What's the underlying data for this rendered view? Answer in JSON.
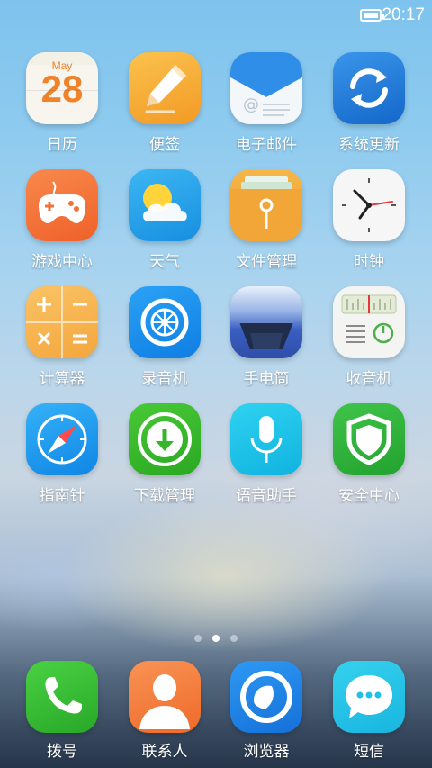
{
  "status_bar": {
    "time": "20:17"
  },
  "calendar": {
    "month": "May",
    "day": "28"
  },
  "apps": [
    {
      "id": "calendar",
      "label": "日历",
      "icon": "calendar-icon"
    },
    {
      "id": "notes",
      "label": "便签",
      "icon": "pencil-icon"
    },
    {
      "id": "email",
      "label": "电子邮件",
      "icon": "envelope-icon"
    },
    {
      "id": "system-update",
      "label": "系统更新",
      "icon": "refresh-icon"
    },
    {
      "id": "games",
      "label": "游戏中心",
      "icon": "gamepad-icon"
    },
    {
      "id": "weather",
      "label": "天气",
      "icon": "sun-cloud-icon"
    },
    {
      "id": "file-manager",
      "label": "文件管理",
      "icon": "folder-icon"
    },
    {
      "id": "clock",
      "label": "时钟",
      "icon": "clock-icon"
    },
    {
      "id": "calculator",
      "label": "计算器",
      "icon": "calculator-icon"
    },
    {
      "id": "recorder",
      "label": "录音机",
      "icon": "recorder-icon"
    },
    {
      "id": "flashlight",
      "label": "手电筒",
      "icon": "flashlight-icon"
    },
    {
      "id": "radio",
      "label": "收音机",
      "icon": "radio-icon"
    },
    {
      "id": "compass",
      "label": "指南针",
      "icon": "compass-icon"
    },
    {
      "id": "downloads",
      "label": "下载管理",
      "icon": "download-icon"
    },
    {
      "id": "voice-assistant",
      "label": "语音助手",
      "icon": "microphone-icon"
    },
    {
      "id": "security",
      "label": "安全中心",
      "icon": "shield-icon"
    }
  ],
  "dock": [
    {
      "id": "phone",
      "label": "拨号",
      "icon": "phone-icon"
    },
    {
      "id": "contacts",
      "label": "联系人",
      "icon": "contact-icon"
    },
    {
      "id": "browser",
      "label": "浏览器",
      "icon": "browser-icon"
    },
    {
      "id": "messages",
      "label": "短信",
      "icon": "message-icon"
    }
  ],
  "page_indicator": {
    "pages": 3,
    "current": 2
  },
  "colors": {
    "calendar_accent": "#f0822a",
    "notes_bg": "#f8b23c",
    "update_bg": "#1f7fe0",
    "games_bg": "#f5763e",
    "weather_bg": "#2aa8ee",
    "files_bg": "#f2a93c",
    "calculator_bg": "#f8b54c",
    "recorder_bg": "#1a8ff0",
    "flashlight_bg": "#3b61c4",
    "compass_bg": "#1d9ef1",
    "downloads_bg": "#3cbf2c",
    "voice_bg": "#1bc7e8",
    "security_bg": "#32b83a",
    "phone_bg": "#3fc33a",
    "contacts_bg": "#f4803a",
    "browser_bg": "#1f86ef",
    "messages_bg": "#26c5e6"
  }
}
